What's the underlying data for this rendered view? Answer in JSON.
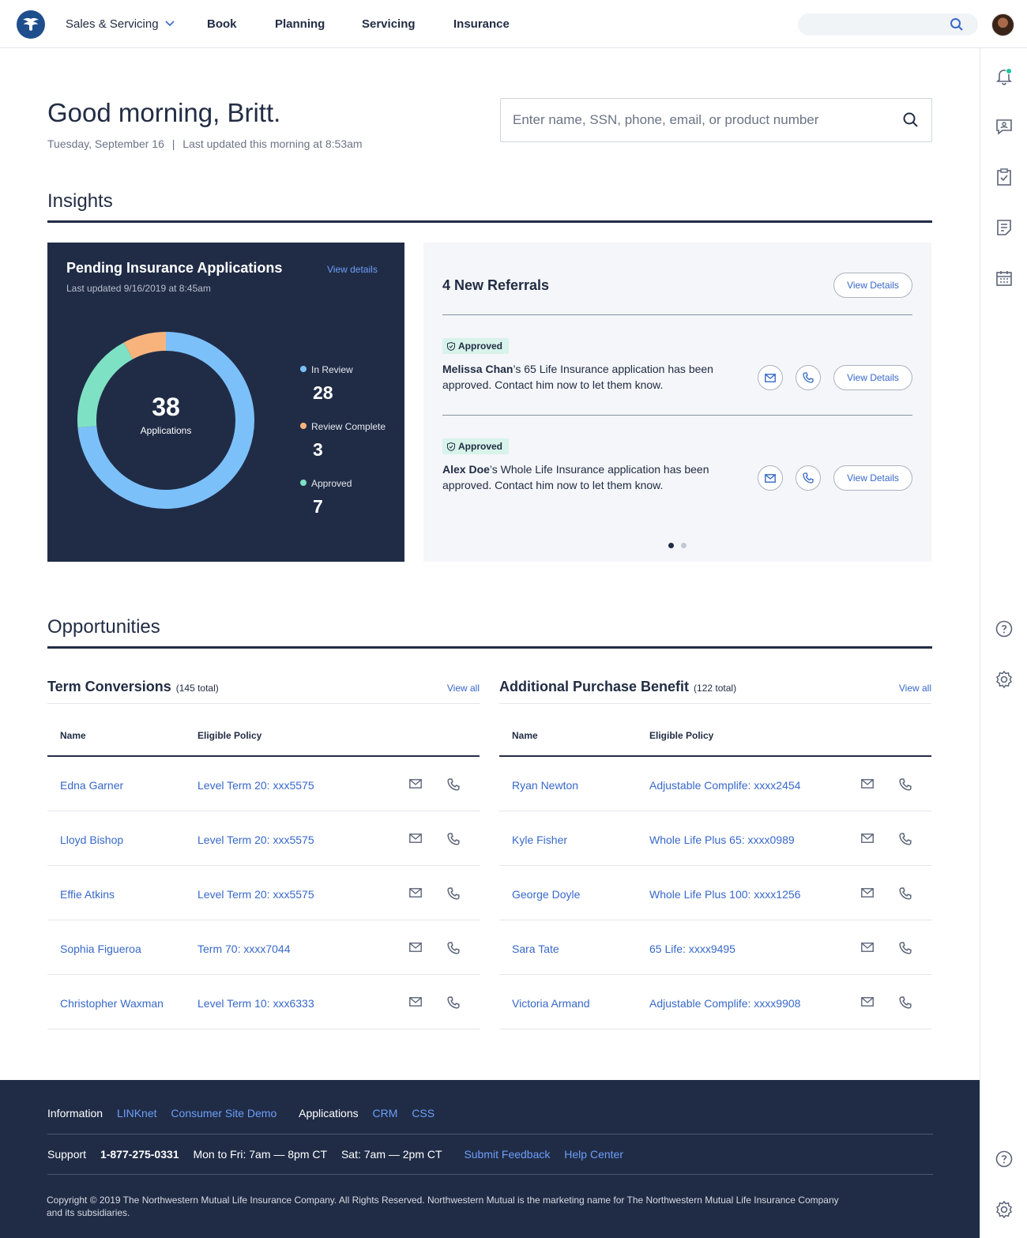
{
  "nav": {
    "brand_icon": "eagle-logo-icon",
    "menu": "Sales & Servicing",
    "items": [
      "Book",
      "Planning",
      "Servicing",
      "Insurance"
    ]
  },
  "header": {
    "greeting": "Good morning, Britt.",
    "date": "Tuesday, September 16",
    "separator": "|",
    "updated": "Last updated this morning at 8:53am",
    "search_placeholder": "Enter name, SSN, phone, email, or product number"
  },
  "insights": {
    "title": "Insights",
    "pending": {
      "title": "Pending Insurance Applications",
      "updated": "Last updated 9/16/2019 at 8:45am",
      "link": "View details",
      "total": "38",
      "total_label": "Applications",
      "legend": [
        {
          "label": "In Review",
          "value": "28",
          "color": "#7cc0fa"
        },
        {
          "label": "Review Complete",
          "value": "3",
          "color": "#f8b37c"
        },
        {
          "label": "Approved",
          "value": "7",
          "color": "#7ee1c4"
        }
      ]
    },
    "referrals": {
      "title": "4 New Referrals",
      "header_button": "View Details",
      "items": [
        {
          "badge": "Approved",
          "name": "Melissa Chan",
          "text": "’s 65 Life Insurance application has been approved. Contact him now to let them know.",
          "button": "View Details"
        },
        {
          "badge": "Approved",
          "name": "Alex Doe",
          "text": "’s Whole Life Insurance application has been approved. Contact him now to let them know.",
          "button": "View Details"
        }
      ],
      "page_count": 2,
      "active_page": 1
    }
  },
  "opportunities": {
    "title": "Opportunities",
    "term": {
      "title": "Term Conversions",
      "count": "(145 total)",
      "link": "View all",
      "col_name": "Name",
      "col_policy": "Eligible Policy",
      "rows": [
        {
          "name": "Edna Garner",
          "policy": "Level Term 20: xxx5575"
        },
        {
          "name": "Lloyd Bishop",
          "policy": "Level Term 20: xxx5575"
        },
        {
          "name": "Effie Atkins",
          "policy": "Level Term 20: xxx5575"
        },
        {
          "name": "Sophia Figueroa",
          "policy": "Term 70: xxxx7044"
        },
        {
          "name": "Christopher Waxman",
          "policy": "Level Term 10: xxx6333"
        }
      ]
    },
    "apb": {
      "title": "Additional Purchase Benefit",
      "count": "(122 total)",
      "link": "View all",
      "col_name": "Name",
      "col_policy": "Eligible Policy",
      "rows": [
        {
          "name": "Ryan Newton",
          "policy": "Adjustable Complife: xxxx2454"
        },
        {
          "name": "Kyle Fisher",
          "policy": "Whole Life Plus 65: xxxx0989"
        },
        {
          "name": "George Doyle",
          "policy": "Whole Life Plus 100: xxxx1256"
        },
        {
          "name": "Sara Tate",
          "policy": "65 Life: xxxx9495"
        },
        {
          "name": "Victoria Armand",
          "policy": "Adjustable Complife: xxxx9908"
        }
      ]
    }
  },
  "footer": {
    "info_label": "Information",
    "info_links": [
      "LINKnet",
      "Consumer Site Demo"
    ],
    "apps_label": "Applications",
    "apps_links": [
      "CRM",
      "CSS"
    ],
    "support_label": "Support",
    "phone": "1-877-275-0331",
    "hours_weekday": "Mon to Fri: 7am — 8pm CT",
    "hours_sat": "Sat: 7am — 2pm CT",
    "support_links": [
      "Submit Feedback",
      "Help Center"
    ],
    "copyright": "Copyright © 2019 The Northwestern Mutual Life Insurance Company. All Rights Reserved. Northwestern Mutual is the marketing name for The Northwestern Mutual Life Insurance Company and its subsidiaries."
  },
  "rail_icons": [
    "bell-icon",
    "chat-icon",
    "clipboard-check-icon",
    "notes-icon",
    "calendar-icon",
    "help-icon",
    "settings-icon",
    "help-icon",
    "settings-icon"
  ],
  "colors": {
    "navy": "#202c46",
    "link": "#3768c9",
    "notification": "#1cc79a"
  }
}
